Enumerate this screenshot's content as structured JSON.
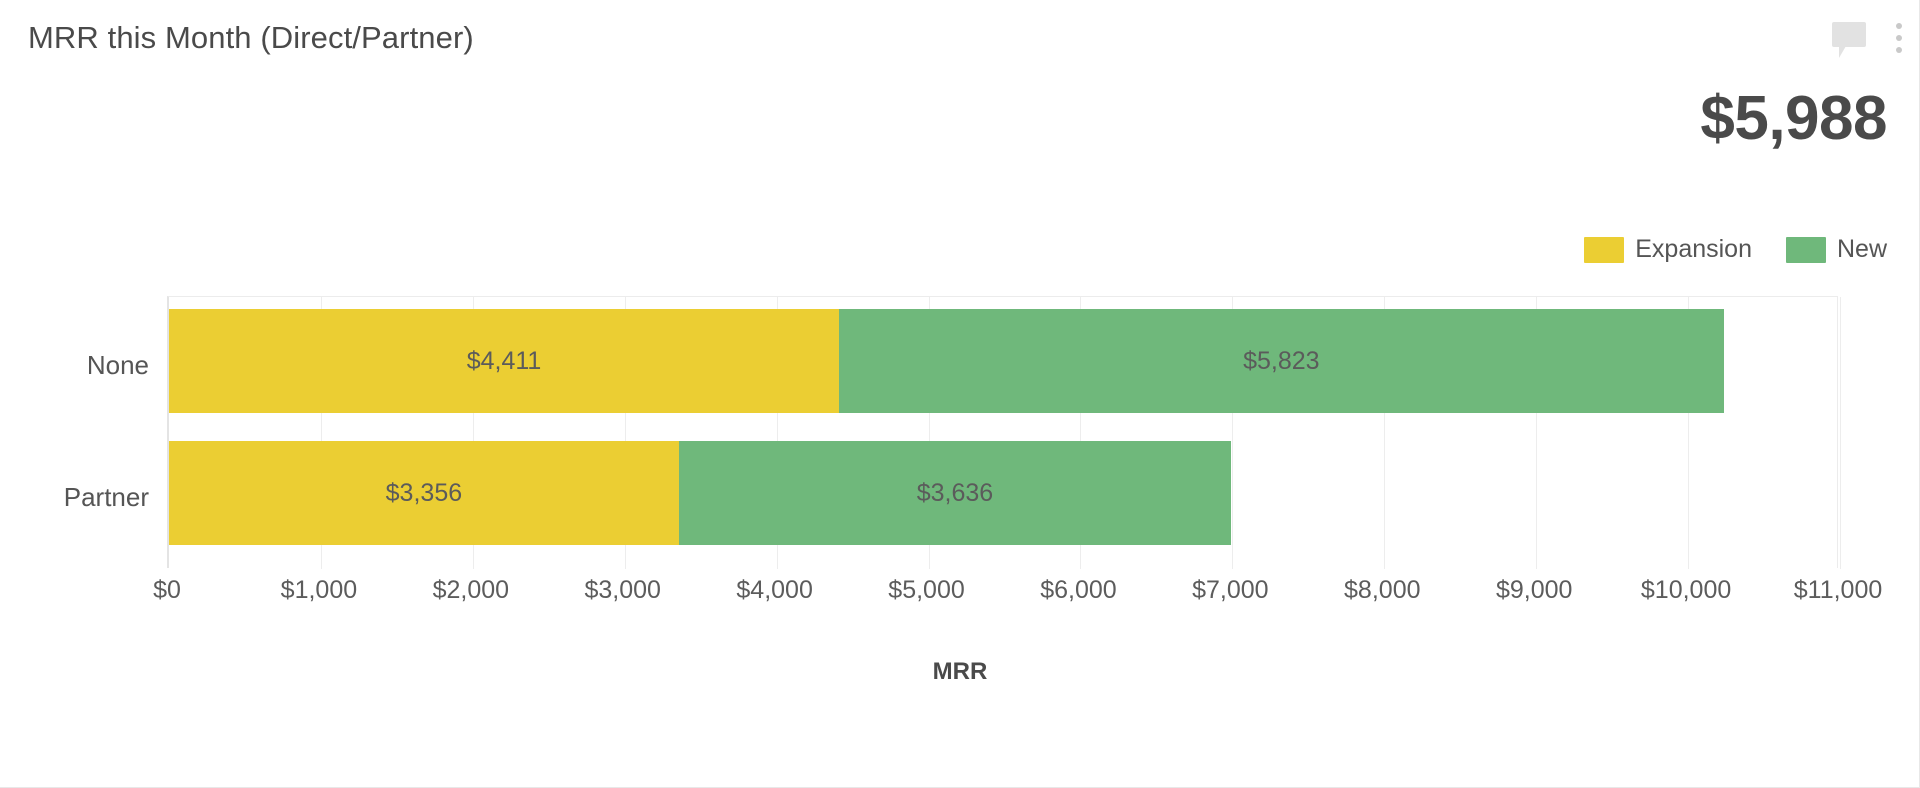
{
  "card": {
    "title": "MRR this Month (Direct/Partner)",
    "big_value": "$5,988",
    "icons": {
      "comment": "comment-icon",
      "menu": "kebab-menu-icon"
    }
  },
  "chart_data": {
    "type": "bar",
    "orientation": "horizontal",
    "stacked": true,
    "title": "MRR this Month (Direct/Partner)",
    "xlabel": "MRR",
    "ylabel": "",
    "categories": [
      "None",
      "Partner"
    ],
    "series": [
      {
        "name": "Expansion",
        "color": "#EBCE33",
        "values": [
          4411,
          3356
        ],
        "labels": [
          "$4,411",
          "$3,356"
        ]
      },
      {
        "name": "New",
        "color": "#6FB87B",
        "values": [
          5823,
          3636
        ],
        "labels": [
          "$5,823",
          "$3,636"
        ]
      }
    ],
    "totals": [
      10234,
      6992
    ],
    "xlim": [
      0,
      11000
    ],
    "xticks": [
      0,
      1000,
      2000,
      3000,
      4000,
      5000,
      6000,
      7000,
      8000,
      9000,
      10000,
      11000
    ],
    "xtick_labels": [
      "$0",
      "$1,000",
      "$2,000",
      "$3,000",
      "$4,000",
      "$5,000",
      "$6,000",
      "$7,000",
      "$8,000",
      "$9,000",
      "$10,000",
      "$11,000"
    ],
    "grid": true,
    "legend_position": "top-right",
    "legend": [
      "Expansion",
      "New"
    ]
  }
}
